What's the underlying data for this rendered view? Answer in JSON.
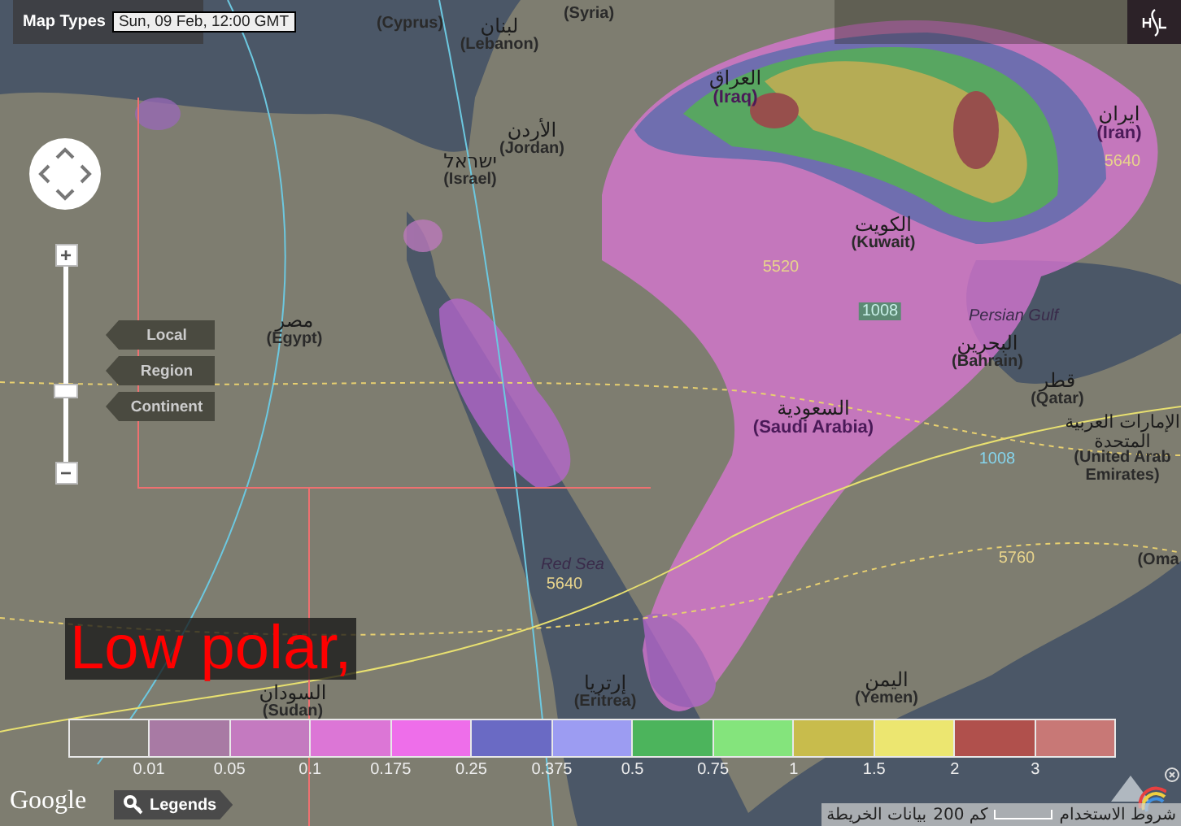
{
  "toolbar": {
    "map_types_label": "Map Types",
    "timestamp": "Sun, 09 Feb, 12:00 GMT"
  },
  "zoom": {
    "plus": "+",
    "minus": "−",
    "level": 0.37
  },
  "scale_buttons": [
    {
      "label": "Local"
    },
    {
      "label": "Region"
    },
    {
      "label": "Continent"
    }
  ],
  "places": [
    {
      "native": "لبنان",
      "english": "(Lebanon)"
    },
    {
      "english": "(Syria)"
    },
    {
      "english": "(Cyprus)"
    },
    {
      "native": "الأردن",
      "english": "(Jordan)"
    },
    {
      "native": "ישראל",
      "english": "(Israel)"
    },
    {
      "native": "العراق",
      "english": "(Iraq)"
    },
    {
      "native": "ایران",
      "english": "(Iran)"
    },
    {
      "native": "الكويت",
      "english": "(Kuwait)"
    },
    {
      "native": "مصر",
      "english": "(Egypt)"
    },
    {
      "native": "السعودية",
      "english": "(Saudi Arabia)"
    },
    {
      "native": "البحرين",
      "english": "(Bahrain)"
    },
    {
      "native": "قطر",
      "english": "(Qatar)"
    },
    {
      "native": "الإمارات العربية المتحدة",
      "english": "(United Arab Emirates)"
    },
    {
      "english": "(Oma"
    },
    {
      "native": "السودان",
      "english": "(Sudan)"
    },
    {
      "native": "إرتريا",
      "english": "(Eritrea)"
    },
    {
      "native": "اليمن",
      "english": "(Yemen)"
    }
  ],
  "water_labels": [
    "Persian Gulf",
    "Red Sea"
  ],
  "contour_labels": [
    {
      "text": "5640",
      "kind": "height"
    },
    {
      "text": "5520",
      "kind": "height"
    },
    {
      "text": "1008",
      "kind": "pressure-box"
    },
    {
      "text": "1008",
      "kind": "pressure"
    },
    {
      "text": "5640",
      "kind": "height"
    },
    {
      "text": "5760",
      "kind": "height"
    }
  ],
  "overlay_text": "Low polar,",
  "legend": [
    {
      "color": "#7d7b72"
    },
    {
      "label": "0.01",
      "color": "#a87aa4"
    },
    {
      "label": "0.05",
      "color": "#c47ac0"
    },
    {
      "label": "0.1",
      "color": "#dc76d6"
    },
    {
      "label": "0.175",
      "color": "#ee6eea"
    },
    {
      "label": "0.25",
      "color": "#6a6ac4"
    },
    {
      "label": "0.375",
      "color": "#9c9cf2"
    },
    {
      "label": "0.5",
      "color": "#4cb45c"
    },
    {
      "label": "0.75",
      "color": "#84e47c"
    },
    {
      "label": "1",
      "color": "#c8bc4c"
    },
    {
      "label": "1.5",
      "color": "#ece670"
    },
    {
      "label": "2",
      "color": "#b0504c"
    },
    {
      "label": "3",
      "color": "#c87876"
    }
  ],
  "footer": {
    "google": "Google",
    "legends_button": "Legends",
    "scale": "200 كم",
    "map_data": "بيانات الخريطة",
    "terms": "شروط الاستخدام"
  }
}
